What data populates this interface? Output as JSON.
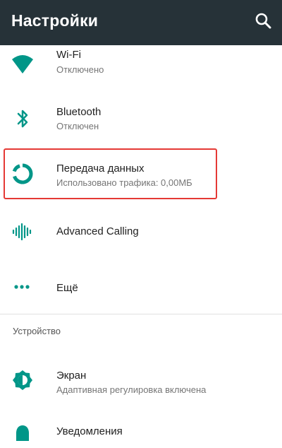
{
  "appbar": {
    "title": "Настройки",
    "search_icon": "search-icon"
  },
  "colors": {
    "accent": "#009688",
    "appbar": "#263238",
    "highlight": "#e53935"
  },
  "items": [
    {
      "title": "Wi-Fi",
      "summary": "Отключено",
      "icon": "wifi-icon"
    },
    {
      "title": "Bluetooth",
      "summary": "Отключен",
      "icon": "bluetooth-icon"
    },
    {
      "title": "Передача данных",
      "summary": "Использовано трафика: 0,00МБ",
      "icon": "data-usage-icon"
    },
    {
      "title": "Advanced Calling",
      "icon": "advanced-calling-icon"
    },
    {
      "title": "Ещё",
      "icon": "more-icon"
    }
  ],
  "section": {
    "label": "Устройство"
  },
  "device_items": [
    {
      "title": "Экран",
      "summary": "Адаптивная регулировка включена",
      "icon": "brightness-icon"
    },
    {
      "title": "Уведомления",
      "icon": "bell-icon"
    }
  ]
}
